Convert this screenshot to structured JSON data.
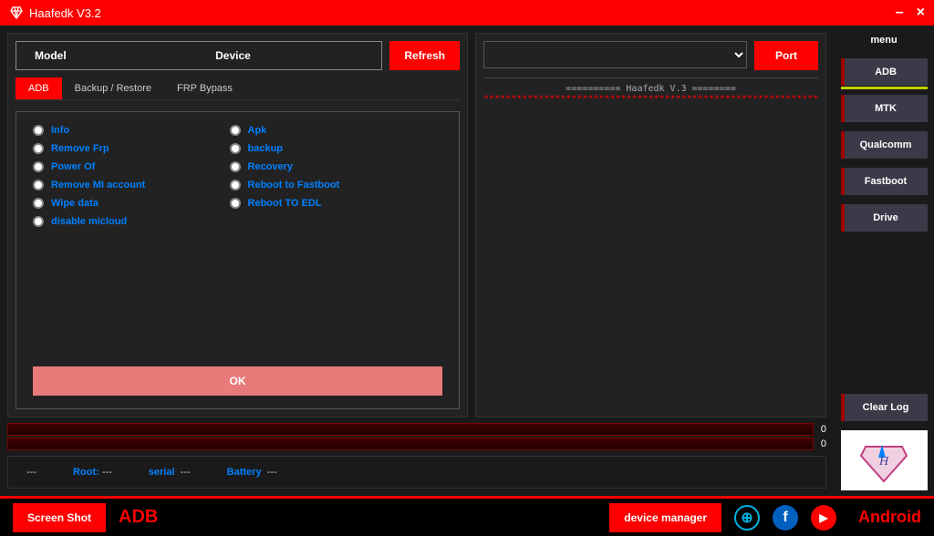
{
  "titlebar": {
    "title": "Haafedk V3.2"
  },
  "model": {
    "label": "Model",
    "device": "Device",
    "refresh": "Refresh"
  },
  "tabs": [
    "ADB",
    "Backup / Restore",
    "FRP Bypass"
  ],
  "options_left": [
    "Info",
    "Remove Frp",
    "Power Of",
    "Remove MI account",
    "Wipe data",
    "disable micloud"
  ],
  "options_right": [
    "Apk",
    "backup",
    "Recovery",
    "Reboot to Fastboot",
    "Reboot TO EDL"
  ],
  "ok": "OK",
  "port": {
    "btn": "Port"
  },
  "log": {
    "header": "========== Haafedk V.3 ========",
    "sep": "************************************************************************"
  },
  "progress": {
    "a": "0",
    "b": "0"
  },
  "info": {
    "dash1": "---",
    "root_lbl": "Root:",
    "root_val": "---",
    "serial_lbl": "serial",
    "serial_val": "---",
    "battery_lbl": "Battery",
    "battery_val": "---"
  },
  "sidebar": {
    "title": "menu",
    "items": [
      "ADB",
      "MTK",
      "Qualcomm",
      "Fastboot",
      "Drive"
    ],
    "clear": "Clear Log"
  },
  "bottom": {
    "screenshot": "Screen Shot",
    "adb": "ADB",
    "devmgr": "device manager",
    "android": "Android"
  }
}
